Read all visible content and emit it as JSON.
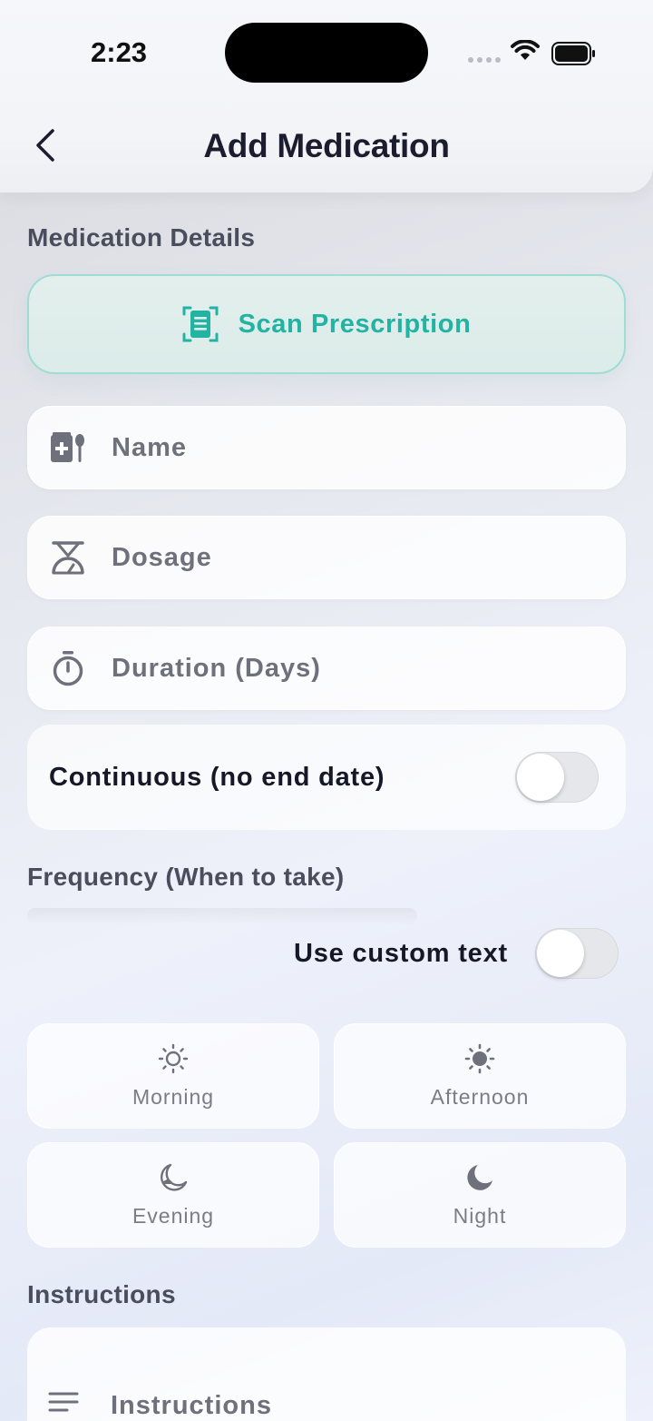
{
  "status_bar": {
    "time": "2:23"
  },
  "header": {
    "title": "Add Medication"
  },
  "sections": {
    "medication_details": "Medication Details",
    "frequency": "Frequency (When to take)",
    "instructions": "Instructions"
  },
  "scan": {
    "label": "Scan Prescription"
  },
  "fields": {
    "name_placeholder": "Name",
    "dosage_placeholder": "Dosage",
    "duration_placeholder": "Duration (Days)",
    "instructions_placeholder": "Instructions"
  },
  "continuous": {
    "label": "Continuous (no end date)",
    "on": false
  },
  "custom_text": {
    "label": "Use custom text",
    "on": false
  },
  "times": [
    {
      "label": "Morning",
      "icon": "sun-outline-icon"
    },
    {
      "label": "Afternoon",
      "icon": "sun-filled-icon"
    },
    {
      "label": "Evening",
      "icon": "moon-outline-icon"
    },
    {
      "label": "Night",
      "icon": "moon-filled-icon"
    }
  ],
  "colors": {
    "accent": "#22b3a3",
    "text": "#1b1d2e",
    "muted": "#6e707b"
  }
}
